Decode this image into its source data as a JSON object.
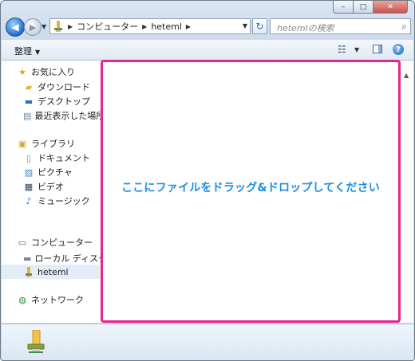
{
  "window": {
    "caption": {
      "minimize": "–",
      "maximize": "□",
      "close": "✕"
    }
  },
  "navigation": {
    "back_icon": "back-arrow-icon",
    "forward_icon": "forward-arrow-icon",
    "recent_icon": "chevron-down-icon"
  },
  "address": {
    "breadcrumb": [
      "コンピューター",
      "heteml"
    ],
    "dropdown_icon": "chevron-down-icon"
  },
  "search": {
    "placeholder": "hetemlの検索",
    "icon": "search-icon"
  },
  "toolbar": {
    "organize_label": "整理",
    "view_icon": "change-view-icon",
    "preview_icon": "preview-pane-icon",
    "help_label": "?"
  },
  "nav_pane": {
    "favorites": {
      "label": "お気に入り",
      "items": [
        "ダウンロード",
        "デスクトップ",
        "最近表示した場所"
      ]
    },
    "libraries": {
      "label": "ライブラリ",
      "items": [
        "ドキュメント",
        "ピクチャ",
        "ビデオ",
        "ミュージック"
      ]
    },
    "computer": {
      "label": "コンピューター",
      "items": [
        "ローカル ディスク (",
        "heteml"
      ]
    },
    "network": {
      "label": "ネットワーク"
    },
    "selected": "heteml"
  },
  "dropzone": {
    "message": "ここにファイルをドラッグ&ドロップしてください",
    "border_color": "#e5268a",
    "text_color": "#1c8fe0"
  }
}
